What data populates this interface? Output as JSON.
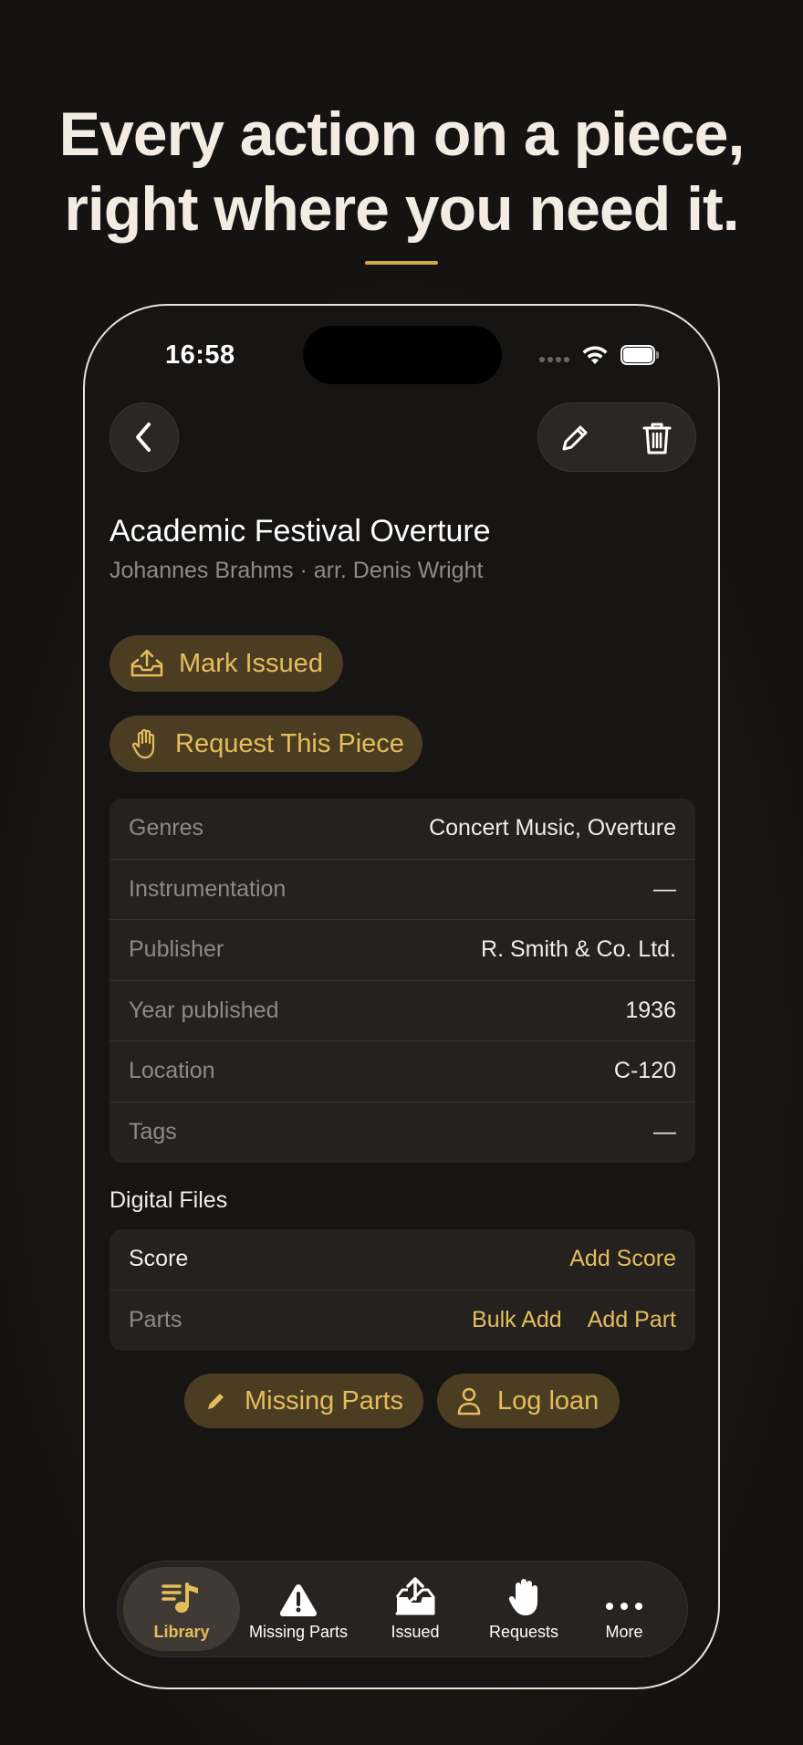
{
  "headline": {
    "line1": "Every action on a piece,",
    "line2": "right where you need it."
  },
  "status_bar": {
    "time": "16:58"
  },
  "icons": {
    "back": "chevron-left-icon",
    "edit": "pencil-icon",
    "delete": "trash-icon",
    "mark_issued": "tray-upload-icon",
    "request": "hand-raised-icon",
    "missing_parts": "pencil-icon",
    "log_loan": "person-icon"
  },
  "piece": {
    "title": "Academic Festival Overture",
    "subtitle": "Johannes Brahms · arr. Denis Wright"
  },
  "actions": {
    "mark_issued": "Mark Issued",
    "request_piece": "Request This Piece",
    "missing_parts": "Missing Parts",
    "log_loan": "Log loan"
  },
  "details": [
    {
      "label": "Genres",
      "value": "Concert Music, Overture"
    },
    {
      "label": "Instrumentation",
      "value": "—"
    },
    {
      "label": "Publisher",
      "value": "R. Smith & Co. Ltd."
    },
    {
      "label": "Year published",
      "value": "1936"
    },
    {
      "label": "Location",
      "value": "C-120"
    },
    {
      "label": "Tags",
      "value": "—"
    }
  ],
  "digital_files": {
    "heading": "Digital Files",
    "score_label": "Score",
    "add_score": "Add Score",
    "parts_label": "Parts",
    "bulk_add": "Bulk Add",
    "add_part": "Add Part"
  },
  "tabbar": {
    "library": "Library",
    "missing_parts": "Missing Parts",
    "issued": "Issued",
    "requests": "Requests",
    "more": "More"
  },
  "colors": {
    "accent": "#e6bd5c",
    "accent_pill_bg": "#4a3d22",
    "background": "#151311",
    "card": "#24211e"
  }
}
